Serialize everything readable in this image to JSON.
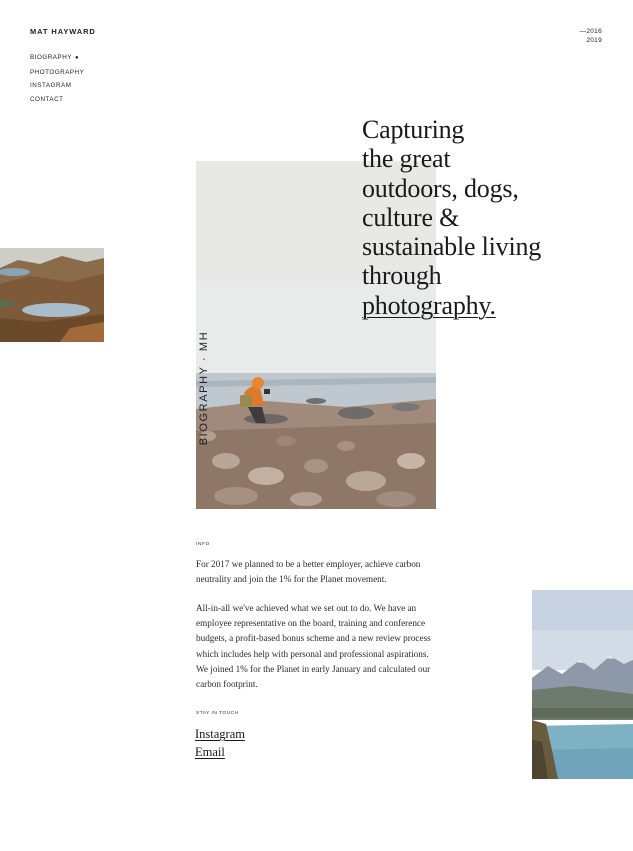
{
  "header": {
    "brand": "MAT HAYWARD",
    "years": [
      "—2016",
      "2019"
    ]
  },
  "nav": {
    "items": [
      {
        "label": "BIOGRAPHY",
        "active": true,
        "marker": "●"
      },
      {
        "label": "PHOTOGRAPHY"
      },
      {
        "label": "INSTAGRAM"
      },
      {
        "label": "CONTACT"
      }
    ]
  },
  "hero": {
    "headline_lines": [
      "Capturing",
      "the great",
      "outdoors, dogs,",
      "culture &",
      "sustainable living",
      "through"
    ],
    "headline_link": "photography.",
    "vertical_label": "BIOGRAPHY · MH"
  },
  "info": {
    "label": "INFO",
    "paragraph_1": "For 2017 we planned to be a better employer, achieve carbon neutrality and join the 1% for the Planet movement.",
    "paragraph_2": "All-in-all we've achieved what we set out to do. We have an employee representative on the board, training and conference budgets, a profit-based bonus scheme and a new review process which includes help with personal and professional aspirations. We joined 1% for the Planet in early January and calculated our carbon footprint."
  },
  "contact": {
    "label": "STAY IN TOUCH",
    "instagram": "Instagram",
    "email": "Email"
  },
  "colors": {
    "text": "#1e1e1e",
    "background": "#ffffff",
    "jacket": "#e07a2a"
  }
}
